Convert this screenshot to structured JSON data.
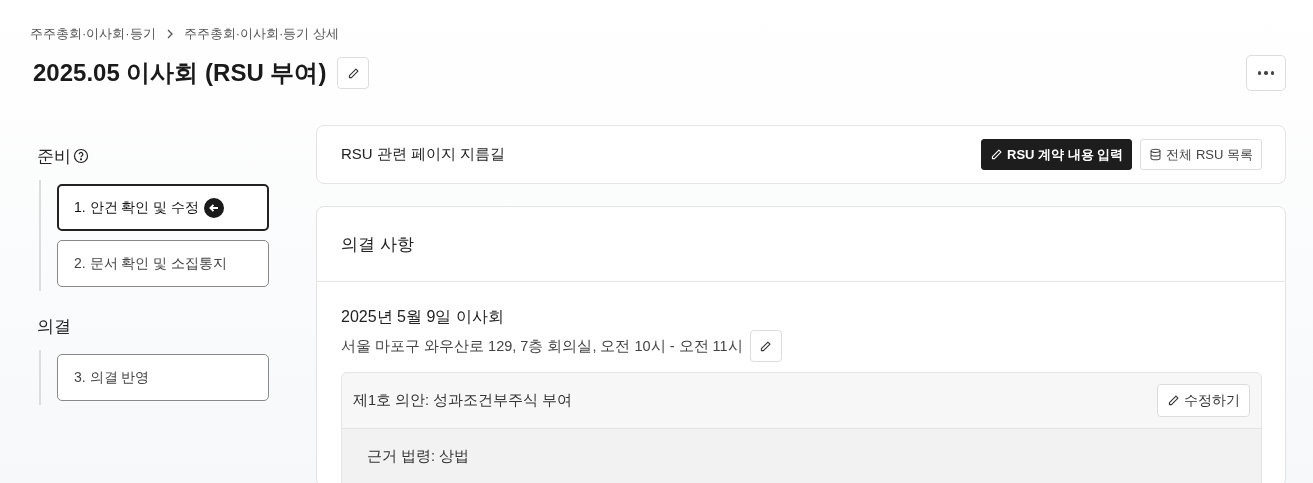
{
  "breadcrumb": [
    {
      "label": "주주총회·이사회·등기"
    },
    {
      "label": "주주총회·이사회·등기 상세"
    }
  ],
  "page_title": "2025.05 이사회 (RSU 부여)",
  "sidebar": {
    "sections": [
      {
        "title": "준비",
        "help": true,
        "steps": [
          {
            "label": "1. 안건 확인 및 수정",
            "selected": true
          },
          {
            "label": "2. 문서 확인 및 소집통지",
            "selected": false
          }
        ]
      },
      {
        "title": "의결",
        "help": false,
        "steps": [
          {
            "label": "3. 의결 반영",
            "selected": false
          }
        ]
      }
    ]
  },
  "shortcuts": {
    "title": "RSU 관련 페이지 지름길",
    "buttons": [
      {
        "label": "RSU 계약 내용 입력",
        "kind": "primary"
      },
      {
        "label": "전체 RSU 목록",
        "kind": "list"
      }
    ]
  },
  "resolutions": {
    "title": "의결 사항",
    "meeting": {
      "title": "2025년 5월 9일 이사회",
      "details": "서울 마포구 와우산로 129, 7층 회의실, 오전 10시 - 오전 11시"
    },
    "agendas": [
      {
        "title": "제1호 의안: 성과조건부주식 부여",
        "edit_label": "수정하기",
        "legal_basis": "근거 법령: 상법"
      }
    ]
  }
}
